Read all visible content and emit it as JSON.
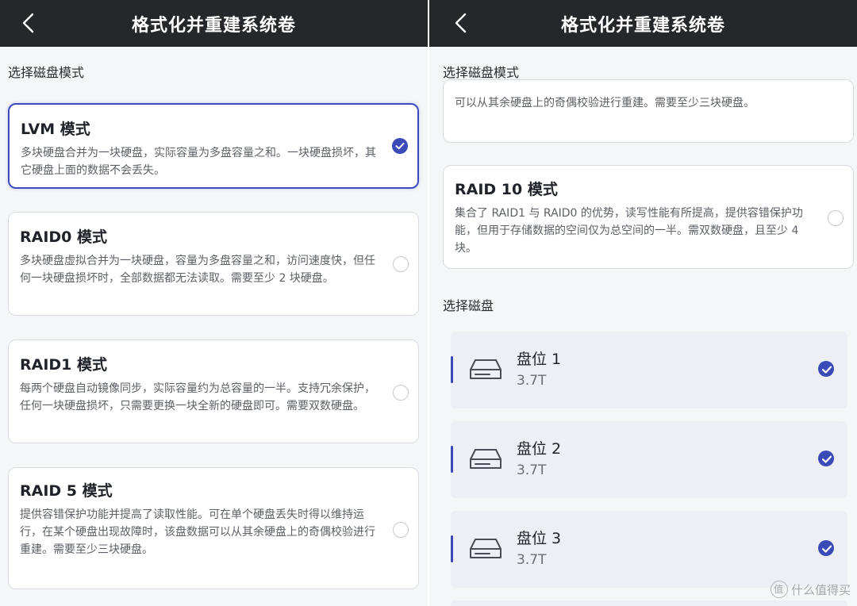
{
  "left_screen": {
    "header_title": "格式化并重建系统卷",
    "section_label": "选择磁盘模式",
    "modes": [
      {
        "title": "LVM 模式",
        "desc": "多块硬盘合并为一块硬盘，实际容量为多盘容量之和。一块硬盘损坏，其它硬盘上面的数据不会丢失。",
        "selected": true
      },
      {
        "title": "RAID0 模式",
        "desc": "多块硬盘虚拟合并为一块硬盘，容量为多盘容量之和，访问速度快，但任何一块硬盘损坏时，全部数据都无法读取。需要至少 2 块硬盘。",
        "selected": false
      },
      {
        "title": "RAID1 模式",
        "desc": "每两个硬盘自动镜像同步，实际容量约为总容量的一半。支持冗余保护，任何一块硬盘损坏，只需要更换一块全新的硬盘即可。需要双数硬盘。",
        "selected": false
      },
      {
        "title": "RAID 5 模式",
        "desc": "提供容错保护功能并提高了读取性能。可在单个硬盘丢失时得以维持运行，在某个硬盘出现故障时，该盘数据可以从其余硬盘上的奇偶校验进行重建。需要至少三块硬盘。",
        "selected": false
      }
    ]
  },
  "right_screen": {
    "header_title": "格式化并重建系统卷",
    "section_label": "选择磁盘模式",
    "partial_card_desc": "可以从其余硬盘上的奇偶校验进行重建。需要至少三块硬盘。",
    "raid10": {
      "title": "RAID 10 模式",
      "desc": "集合了 RAID1 与 RAID0 的优势，读写性能有所提高，提供容错保护功能，但用于存储数据的空间仅为总空间的一半。需双数硬盘，且至少 4 块。",
      "selected": false
    },
    "disk_section_label": "选择磁盘",
    "disks": [
      {
        "name": "盘位 1",
        "size": "3.7T",
        "selected": true
      },
      {
        "name": "盘位 2",
        "size": "3.7T",
        "selected": true
      },
      {
        "name": "盘位 3",
        "size": "3.7T",
        "selected": true
      }
    ]
  },
  "watermark": {
    "text": "什么值得买"
  },
  "colors": {
    "accent": "#3a4bb8",
    "header_bg": "#26272b",
    "page_bg": "#f5f6f8",
    "disk_bg": "#edeff5"
  },
  "icons": {
    "back": "chevron-left-icon",
    "check": "check-circle-icon",
    "disk": "hard-drive-icon"
  }
}
